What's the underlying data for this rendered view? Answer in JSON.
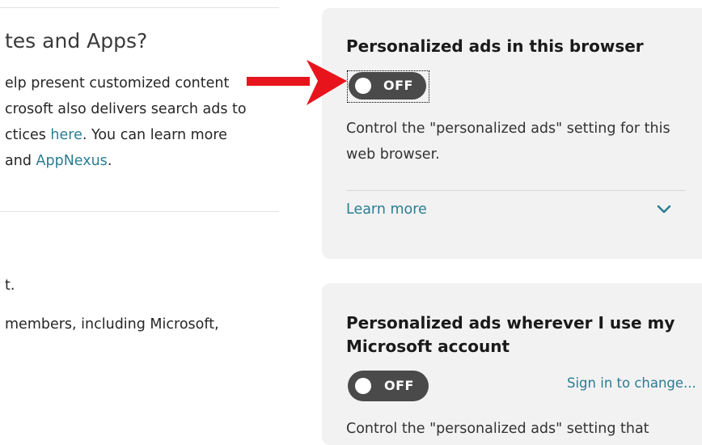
{
  "left": {
    "heading": "tes and Apps?",
    "para1": {
      "line1": "elp present customized content",
      "line2": "crosoft also delivers search ads to",
      "line3_pre": "ctices ",
      "line3_link": "here",
      "line3_post": ". You can learn more",
      "line4_pre": "and ",
      "line4_link": "AppNexus",
      "line4_post": "."
    },
    "para2": {
      "line1": "t.",
      "line2": "members, including Microsoft,"
    }
  },
  "card_browser": {
    "title": "Personalized ads in this browser",
    "toggle_state": "OFF",
    "description": "Control the \"personalized ads\" setting for this web browser.",
    "learn_more": "Learn more",
    "chevron_icon": "chevron-down-icon"
  },
  "card_account": {
    "title": "Personalized ads wherever I use my Microsoft account",
    "toggle_state": "OFF",
    "sign_in": "Sign in to change...",
    "description": "Control the \"personalized ads\" setting that"
  },
  "annotation": {
    "arrow_color": "#e8141c",
    "arrow_icon": "arrow-right-icon"
  },
  "colors": {
    "link": "#2b7d92",
    "card_bg": "#f2f2f2",
    "toggle_bg": "#4a4a4a"
  }
}
